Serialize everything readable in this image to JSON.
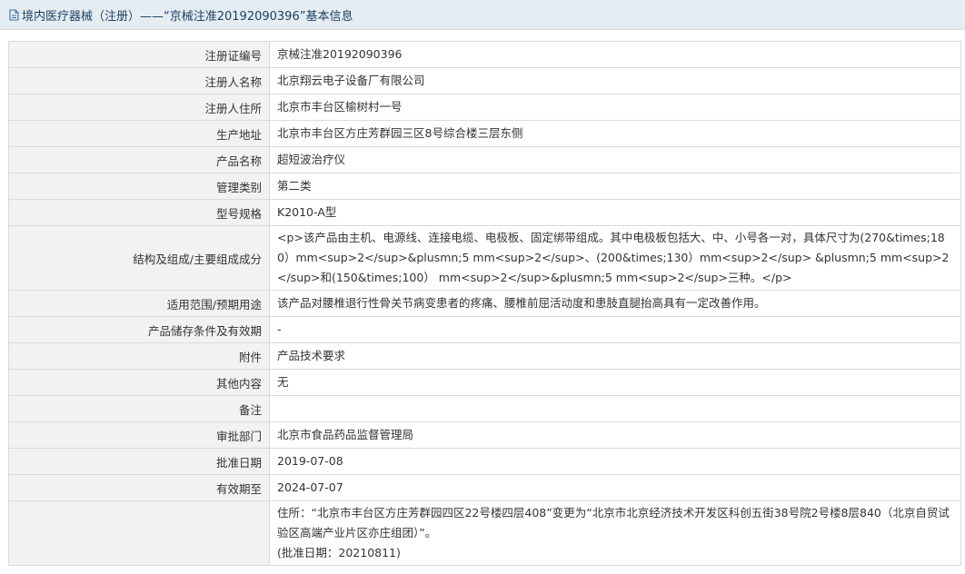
{
  "header": {
    "title": "境内医疗器械（注册）——“京械注准20192090396”基本信息",
    "icon": "document-icon"
  },
  "rows": [
    {
      "key": "注册证编号",
      "value": "京械注准20192090396"
    },
    {
      "key": "注册人名称",
      "value": "北京翔云电子设备厂有限公司"
    },
    {
      "key": "注册人住所",
      "value": "北京市丰台区榆树村一号"
    },
    {
      "key": "生产地址",
      "value": "北京市丰台区方庄芳群园三区8号综合楼三层东侧"
    },
    {
      "key": "产品名称",
      "value": "超短波治疗仪"
    },
    {
      "key": "管理类别",
      "value": "第二类"
    },
    {
      "key": "型号规格",
      "value": "K2010-A型"
    },
    {
      "key": "结构及组成/主要组成成分",
      "value": "<p>该产品由主机、电源线、连接电缆、电极板、固定绑带组成。其中电极板包括大、中、小号各一对，具体尺寸为(270&times;180）mm<sup>2</sup>&plusmn;5 mm<sup>2</sup>、(200&times;130）mm<sup>2</sup> &plusmn;5 mm<sup>2</sup>和(150&times;100） mm<sup>2</sup>&plusmn;5 mm<sup>2</sup>三种。</p>"
    },
    {
      "key": "适用范围/预期用途",
      "value": "该产品对腰椎退行性骨关节病变患者的疼痛、腰椎前屈活动度和患肢直腿抬高具有一定改善作用。"
    },
    {
      "key": "产品储存条件及有效期",
      "value": "-"
    },
    {
      "key": "附件",
      "value": "产品技术要求"
    },
    {
      "key": "其他内容",
      "value": "无"
    },
    {
      "key": "备注",
      "value": ""
    },
    {
      "key": "审批部门",
      "value": "北京市食品药品监督管理局"
    },
    {
      "key": "批准日期",
      "value": "2019-07-08"
    },
    {
      "key": "有效期至",
      "value": "2024-07-07"
    },
    {
      "key": "",
      "value": "住所：“北京市丰台区方庄芳群园四区22号楼四层408”变更为“北京市北京经济技术开发区科创五街38号院2号楼8层840（北京自贸试验区高端产业片区亦庄组团）”。\n(批准日期：20210811)"
    }
  ]
}
